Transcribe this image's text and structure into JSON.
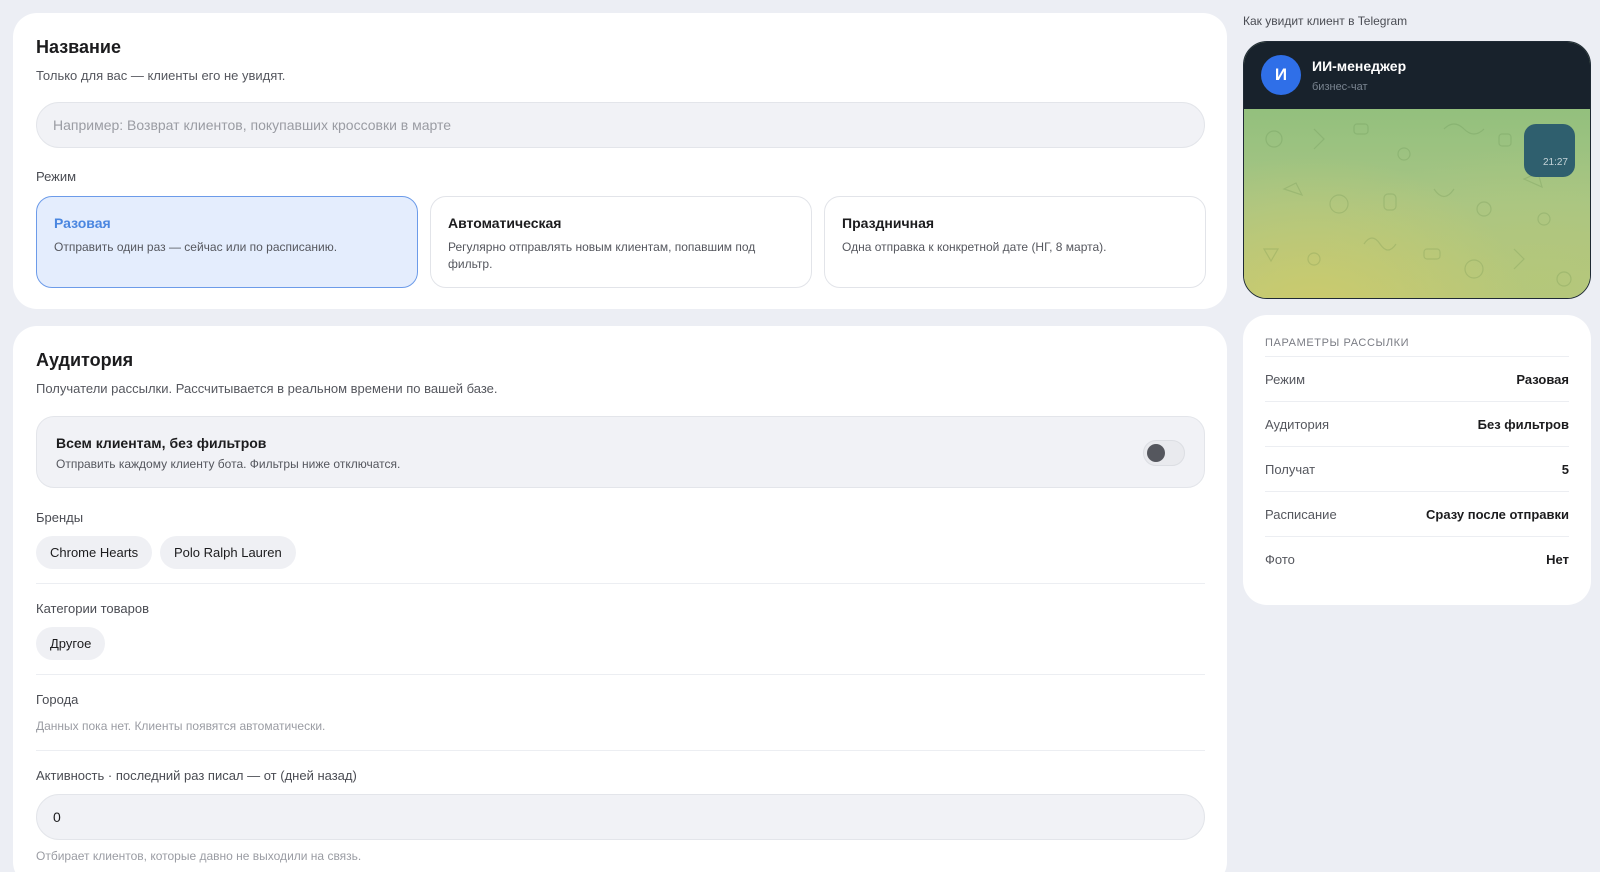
{
  "name_section": {
    "title": "Название",
    "subtitle": "Только для вас — клиенты его не увидят.",
    "name_input": {
      "value": "",
      "placeholder": "Например: Возврат клиентов, покупавших кроссовки в марте"
    },
    "mode_label": "Режим",
    "modes": [
      {
        "title": "Разовая",
        "description": "Отправить один раз — сейчас или по расписанию.",
        "selected": true
      },
      {
        "title": "Автоматическая",
        "description": "Регулярно отправлять новым клиентам, попавшим под фильтр.",
        "selected": false
      },
      {
        "title": "Праздничная",
        "description": "Одна отправка к конкретной дате (НГ, 8 марта).",
        "selected": false
      }
    ]
  },
  "audience_section": {
    "title": "Аудитория",
    "subtitle": "Получатели рассылки. Рассчитывается в реальном времени по вашей базе.",
    "all_clients": {
      "title": "Всем клиентам, без фильтров",
      "description": "Отправить каждому клиенту бота. Фильтры ниже отключатся.",
      "enabled": false
    },
    "brands": {
      "label": "Бренды",
      "chips": [
        "Chrome Hearts",
        "Polo Ralph Lauren"
      ]
    },
    "categories": {
      "label": "Категории товаров",
      "chips": [
        "Другое"
      ]
    },
    "cities": {
      "label": "Города",
      "empty_text": "Данных пока нет. Клиенты появятся автоматически."
    },
    "activity": {
      "label": "Активность · последний раз писал — от (дней назад)",
      "value": "0",
      "hint": "Отбирает клиентов, которые давно не выходили на связь."
    }
  },
  "preview": {
    "caption": "Как увидит клиент в Telegram",
    "avatar_letter": "И",
    "bot_name": "ИИ-менеджер",
    "bot_status": "бизнес-чат",
    "message_time": "21:27",
    "avatar_color": "#2f6fe8",
    "header_color": "#18222c"
  },
  "params": {
    "title": "ПАРАМЕТРЫ РАССЫЛКИ",
    "rows": [
      {
        "key": "Режим",
        "value": "Разовая"
      },
      {
        "key": "Аудитория",
        "value": "Без фильтров"
      },
      {
        "key": "Получат",
        "value": "5"
      },
      {
        "key": "Расписание",
        "value": "Сразу после отправки"
      },
      {
        "key": "Фото",
        "value": "Нет"
      }
    ]
  },
  "colors": {
    "accent": "#4a86e0",
    "selected_bg": "#e4edfd",
    "page_bg": "#eceef4"
  }
}
